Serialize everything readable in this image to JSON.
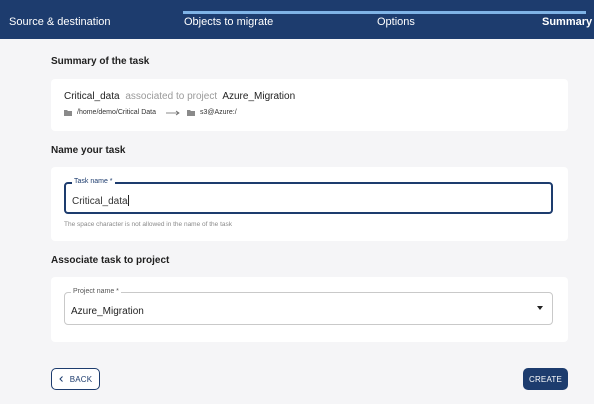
{
  "stepper": {
    "steps": [
      {
        "label": "Source & destination",
        "state": "done"
      },
      {
        "label": "Objects to migrate",
        "state": "done"
      },
      {
        "label": "Options",
        "state": "done"
      },
      {
        "label": "Summary",
        "state": "active"
      }
    ]
  },
  "summary": {
    "title": "Summary of the task",
    "task_name": "Critical_data",
    "associated_text": "associated to project",
    "project_name": "Azure_Migration",
    "source_path": "/home/demo/Critical Data",
    "destination_path": "s3@Azure:/"
  },
  "name_section": {
    "title": "Name your task",
    "field_label": "Task name *",
    "field_value": "Critical_data",
    "helper_text": "The space character is not allowed in the name of the task"
  },
  "project_section": {
    "title": "Associate task to project",
    "field_label": "Project name *",
    "selected_value": "Azure_Migration"
  },
  "actions": {
    "back_label": "BACK",
    "create_label": "CREATE"
  },
  "colors": {
    "header": "#1d3c6e",
    "progress": "#7fb3e6",
    "primary": "#1d3c6e",
    "background": "#f5f5f7"
  },
  "icons": [
    "folder-icon",
    "arrow-right-icon",
    "chevron-left-icon",
    "dropdown-arrow-icon"
  ]
}
